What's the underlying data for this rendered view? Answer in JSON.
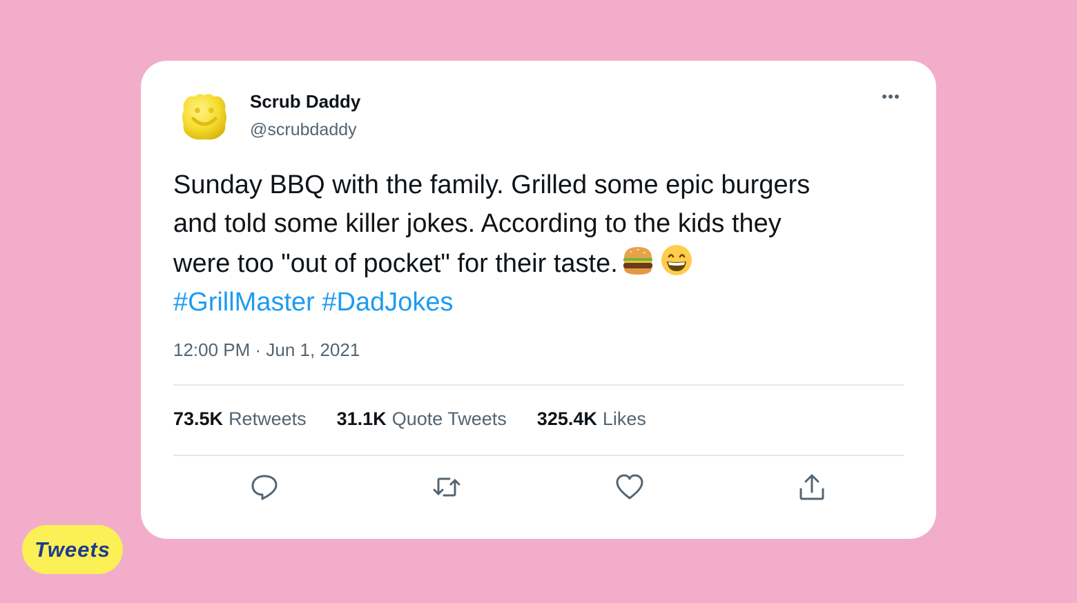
{
  "tweet": {
    "author": {
      "display_name": "Scrub Daddy",
      "handle": "@scrubdaddy",
      "avatar_icon": "scrub-daddy-smiley-sponge"
    },
    "text_lines": [
      "Sunday BBQ with the family. Grilled some epic burgers",
      "and told some killer jokes. According to the kids they",
      "were too \"out of pocket\" for their taste."
    ],
    "emojis": [
      "burger-emoji",
      "grinning-face-emoji"
    ],
    "hashtags": [
      "#GrillMaster",
      "#DadJokes"
    ],
    "timestamp": "12:00 PM · Jun 1, 2021",
    "stats": {
      "retweets": {
        "count": "73.5K",
        "label": "Retweets"
      },
      "quote_tweets": {
        "count": "31.1K",
        "label": "Quote Tweets"
      },
      "likes": {
        "count": "325.4K",
        "label": "Likes"
      }
    },
    "actions": [
      "reply-icon",
      "retweet-icon",
      "like-icon",
      "share-icon"
    ]
  },
  "badge": {
    "label": "Tweets"
  },
  "colors": {
    "background": "#f2adca",
    "card": "#ffffff",
    "hashtag": "#1d9bf0",
    "secondary_text": "#536471",
    "badge_bg": "#fbf055",
    "badge_text": "#1f3c8c"
  }
}
